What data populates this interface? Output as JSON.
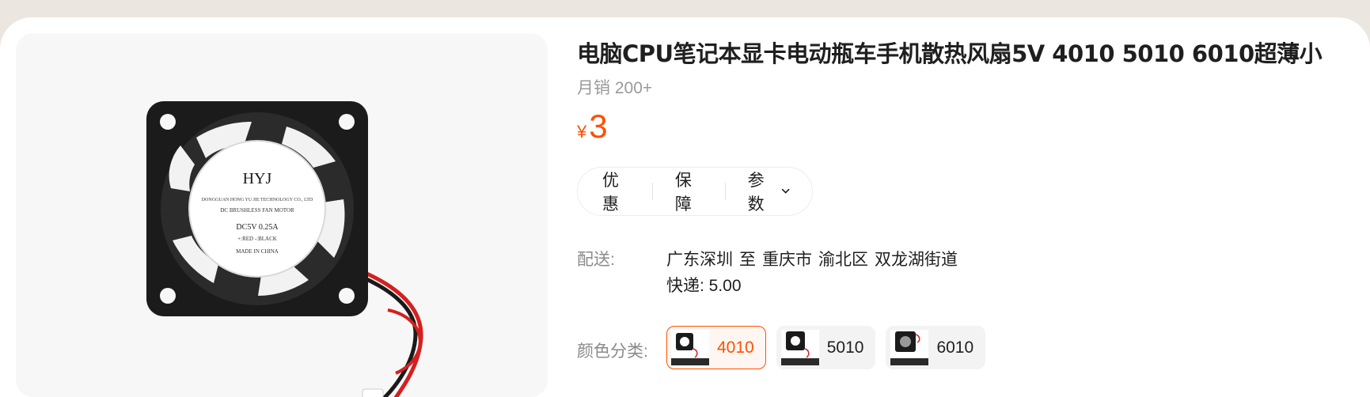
{
  "product": {
    "title": "电脑CPU笔记本显卡电动瓶车手机散热风扇5V 4010 5010 6010超薄小",
    "sales": "月销 200+",
    "price": {
      "currency": "¥",
      "value": "3"
    },
    "image_text": {
      "brand": "HYJ",
      "company": "DONGGUAN HONG YU JIE TECHNOLOGY CO., LTD",
      "motor": "DC BRUSHLESS FAN MOTOR",
      "rating": "DC5V 0.25A",
      "wires": "+:RED  -:BLACK",
      "origin": "MADE IN CHINA"
    }
  },
  "tabs": [
    {
      "label": "优惠"
    },
    {
      "label": "保障"
    },
    {
      "label": "参数",
      "icon": "chevron-down-icon"
    }
  ],
  "shipping": {
    "label": "配送:",
    "from": "广东深圳",
    "to_word": "至",
    "dest_city": "重庆市",
    "dest_district": "渝北区",
    "dest_street": "双龙湖街道",
    "courier": "快递: 5.00"
  },
  "color_options": {
    "label": "颜色分类:",
    "selected_index": 0,
    "items": [
      {
        "label": "4010"
      },
      {
        "label": "5010"
      },
      {
        "label": "6010"
      }
    ]
  },
  "colors": {
    "accent": "#ff5000",
    "text": "#1f1f1f",
    "muted": "#9a9a9a"
  }
}
